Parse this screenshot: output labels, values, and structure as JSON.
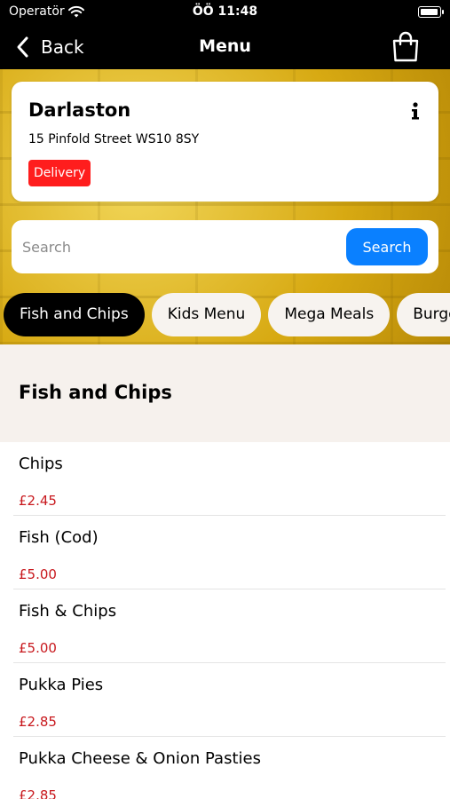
{
  "status_bar": {
    "carrier": "Operatör",
    "time": "ÖÖ 11:48"
  },
  "nav": {
    "back_label": "Back",
    "title": "Menu"
  },
  "store": {
    "name": "Darlaston",
    "address": "15 Pinfold Street WS10 8SY",
    "badge": "Delivery"
  },
  "search": {
    "placeholder": "Search",
    "button_label": "Search"
  },
  "categories": [
    "Fish and Chips",
    "Kids Menu",
    "Mega Meals",
    "Burgers"
  ],
  "active_category": "Fish and Chips",
  "section": {
    "title": "Fish and Chips"
  },
  "items": [
    {
      "name": "Chips",
      "price": "£2.45"
    },
    {
      "name": "Fish (Cod)",
      "price": "£5.00"
    },
    {
      "name": "Fish & Chips",
      "price": "£5.00"
    },
    {
      "name": "Pukka Pies",
      "price": "£2.85"
    },
    {
      "name": "Pukka Cheese & Onion Pasties",
      "price": "£2.85"
    }
  ],
  "colors": {
    "accent_blue": "#0a80ff",
    "delivery_red": "#ff1d1d",
    "price_red": "#c8191e",
    "hero_yellow": "#e3b91c"
  },
  "icons": {
    "back": "chevron-left-icon",
    "cart": "shopping-bag-icon",
    "info": "info-icon",
    "wifi": "wifi-icon",
    "battery": "battery-icon"
  }
}
